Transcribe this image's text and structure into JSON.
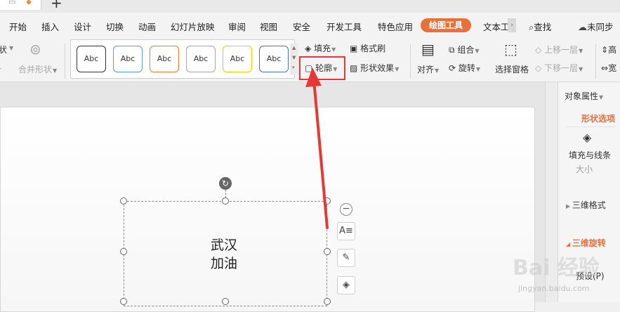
{
  "menu": {
    "tabs": [
      "开始",
      "插入",
      "设计",
      "切换",
      "动画",
      "幻灯片放映",
      "审阅",
      "视图",
      "安全",
      "开发工具",
      "特色应用",
      "绘图工具",
      "文本工"
    ],
    "search_label": "查找",
    "sync_label": "未同步"
  },
  "ribbon": {
    "shape_partial": "状",
    "merge_shapes": "合并形状",
    "style_swatches": [
      {
        "label": "Abc",
        "border_color": "#333333"
      },
      {
        "label": "Abc",
        "border_color": "#5b9bd5"
      },
      {
        "label": "Abc",
        "border_color": "#ed7d31"
      },
      {
        "label": "Abc",
        "border_color": "#a5a5a5"
      },
      {
        "label": "Abc",
        "border_color": "#ffc000"
      },
      {
        "label": "Abc",
        "border_color": "#4472c4"
      }
    ],
    "fill": "填充",
    "format_painter": "格式刷",
    "outline": "轮廓",
    "shape_effects": "形状效果",
    "align": "对齐",
    "group": "组合",
    "rotate": "旋转",
    "selection_pane": "选择窗格",
    "bring_forward": "上移一层",
    "send_backward": "下移一层",
    "cut_top": "高",
    "cut_bottom": "宽"
  },
  "slide": {
    "text_line_1": "武汉",
    "text_line_2": "加油"
  },
  "panel": {
    "title": "对象属性",
    "shape_options": "形状选项",
    "fill_and_line": "填充与线条",
    "size_partial": "大小",
    "three_d_format": "三维格式",
    "three_d_rotation": "三维旋转",
    "preset": "预设(P)"
  },
  "watermark": {
    "main": "Bai 经验",
    "sub": "jingyan.baidu.com"
  },
  "colors": {
    "accent": "#e8703a",
    "highlight_red": "#e53935"
  }
}
